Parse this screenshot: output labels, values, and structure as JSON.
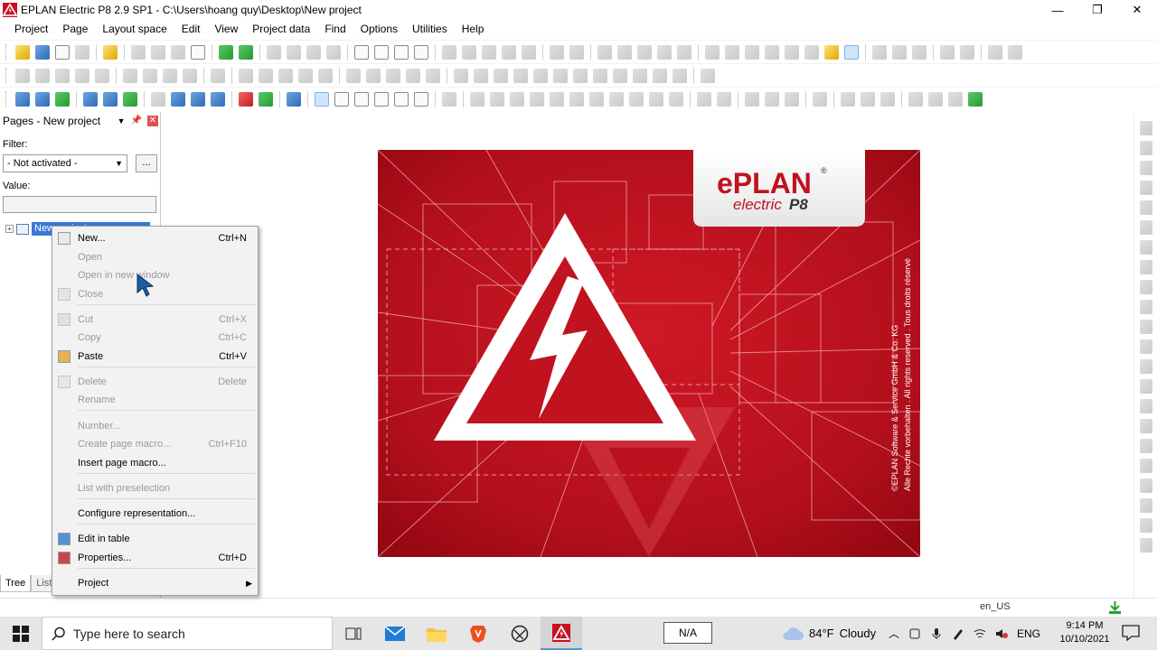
{
  "window": {
    "title": "EPLAN Electric P8 2.9 SP1 - C:\\Users\\hoang quy\\Desktop\\New project",
    "minimize": "—",
    "maximize": "❐",
    "close": "✕"
  },
  "menu": [
    "Project",
    "Page",
    "Layout space",
    "Edit",
    "View",
    "Project data",
    "Find",
    "Options",
    "Utilities",
    "Help"
  ],
  "panel": {
    "title": "Pages - New project",
    "filter_label": "Filter:",
    "filter_value": "- Not activated -",
    "filter_button": "...",
    "value_label": "Value:",
    "value_field": "",
    "tree_item": "New project",
    "tabs": [
      "Tree",
      "List"
    ]
  },
  "context_menu": {
    "items": [
      {
        "label": "New...",
        "shortcut": "Ctrl+N",
        "enabled": true,
        "icon": "new-page-icon"
      },
      {
        "label": "Open",
        "shortcut": "",
        "enabled": false,
        "icon": ""
      },
      {
        "label": "Open in new window",
        "shortcut": "",
        "enabled": false,
        "icon": ""
      },
      {
        "label": "Close",
        "shortcut": "",
        "enabled": false,
        "icon": "close-page-icon"
      },
      {
        "label": "Cut",
        "shortcut": "Ctrl+X",
        "enabled": false,
        "icon": "cut-icon"
      },
      {
        "label": "Copy",
        "shortcut": "Ctrl+C",
        "enabled": false,
        "icon": ""
      },
      {
        "label": "Paste",
        "shortcut": "Ctrl+V",
        "enabled": true,
        "icon": "paste-icon"
      },
      {
        "label": "Delete",
        "shortcut": "Delete",
        "enabled": false,
        "icon": "delete-icon"
      },
      {
        "label": "Rename",
        "shortcut": "",
        "enabled": false,
        "icon": ""
      },
      {
        "label": "Number...",
        "shortcut": "",
        "enabled": false,
        "icon": ""
      },
      {
        "label": "Create page macro...",
        "shortcut": "Ctrl+F10",
        "enabled": false,
        "icon": ""
      },
      {
        "label": "Insert page macro...",
        "shortcut": "",
        "enabled": true,
        "icon": ""
      },
      {
        "label": "List with preselection",
        "shortcut": "",
        "enabled": false,
        "icon": ""
      },
      {
        "label": "Configure representation...",
        "shortcut": "",
        "enabled": true,
        "icon": ""
      },
      {
        "label": "Edit in table",
        "shortcut": "",
        "enabled": true,
        "icon": "table-icon"
      },
      {
        "label": "Properties...",
        "shortcut": "Ctrl+D",
        "enabled": true,
        "icon": "properties-icon"
      },
      {
        "label": "Project",
        "shortcut": "",
        "enabled": true,
        "icon": "",
        "submenu": true
      }
    ]
  },
  "splash": {
    "logo_text": "ePLAN",
    "logo_registered": "®",
    "product": "electric",
    "product_version": "P8",
    "copyright_line1": "©EPLAN Software & Service GmbH & Co. KG",
    "copyright_line2": "Alle Rechte vorbehalten . All rights reserved . Tous droits réservé"
  },
  "status": {
    "locale": "en_US"
  },
  "taskbar": {
    "search_placeholder": "Type here to search",
    "na_label": "N/A",
    "weather_temp": "84°F",
    "weather_desc": "Cloudy",
    "language": "ENG",
    "time": "9:14 PM",
    "date": "10/10/2021"
  },
  "colors": {
    "eplan_red": "#b8101c",
    "selection_blue": "#3a78d6",
    "taskbar_bg": "#e6e6e6"
  }
}
